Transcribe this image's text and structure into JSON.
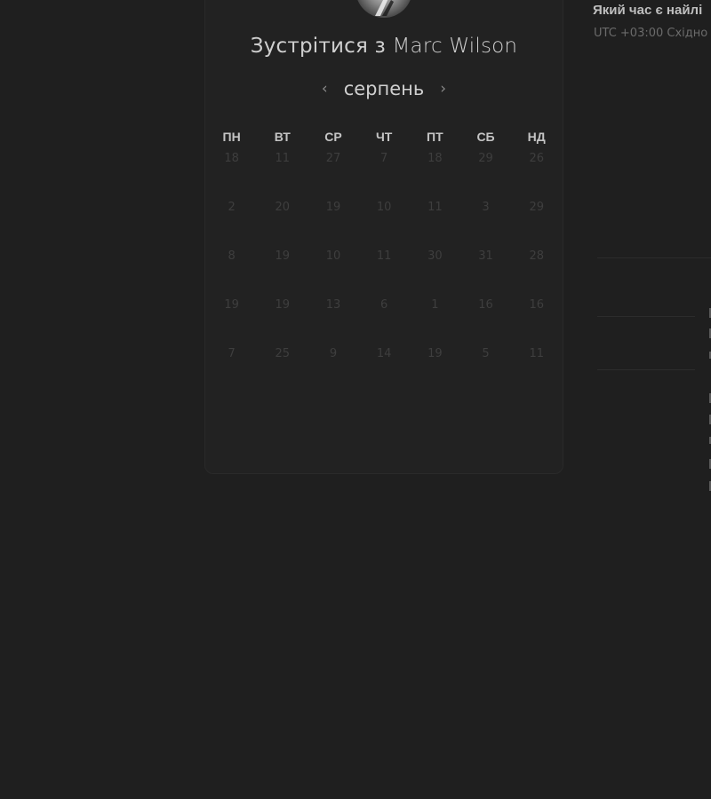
{
  "booking": {
    "title_prefix": "Зустрітися з",
    "host_name": "Marc Wilson"
  },
  "calendar": {
    "month": "серпень",
    "prev_icon": "‹",
    "next_icon": "›",
    "weekdays": [
      "ПН",
      "ВТ",
      "СР",
      "ЧТ",
      "ПТ",
      "СБ",
      "НД"
    ],
    "weeks": [
      [
        "18",
        "11",
        "27",
        "7",
        "18",
        "29",
        "26"
      ],
      [
        "2",
        "20",
        "19",
        "10",
        "11",
        "3",
        "29"
      ],
      [
        "8",
        "19",
        "10",
        "11",
        "30",
        "31",
        "28"
      ],
      [
        "19",
        "19",
        "13",
        "6",
        "1",
        "16",
        "16"
      ],
      [
        "7",
        "25",
        "9",
        "14",
        "19",
        "5",
        "11"
      ]
    ]
  },
  "time_panel": {
    "title": "Який час є найлі",
    "timezone": "UTC +03:00 Східно"
  }
}
